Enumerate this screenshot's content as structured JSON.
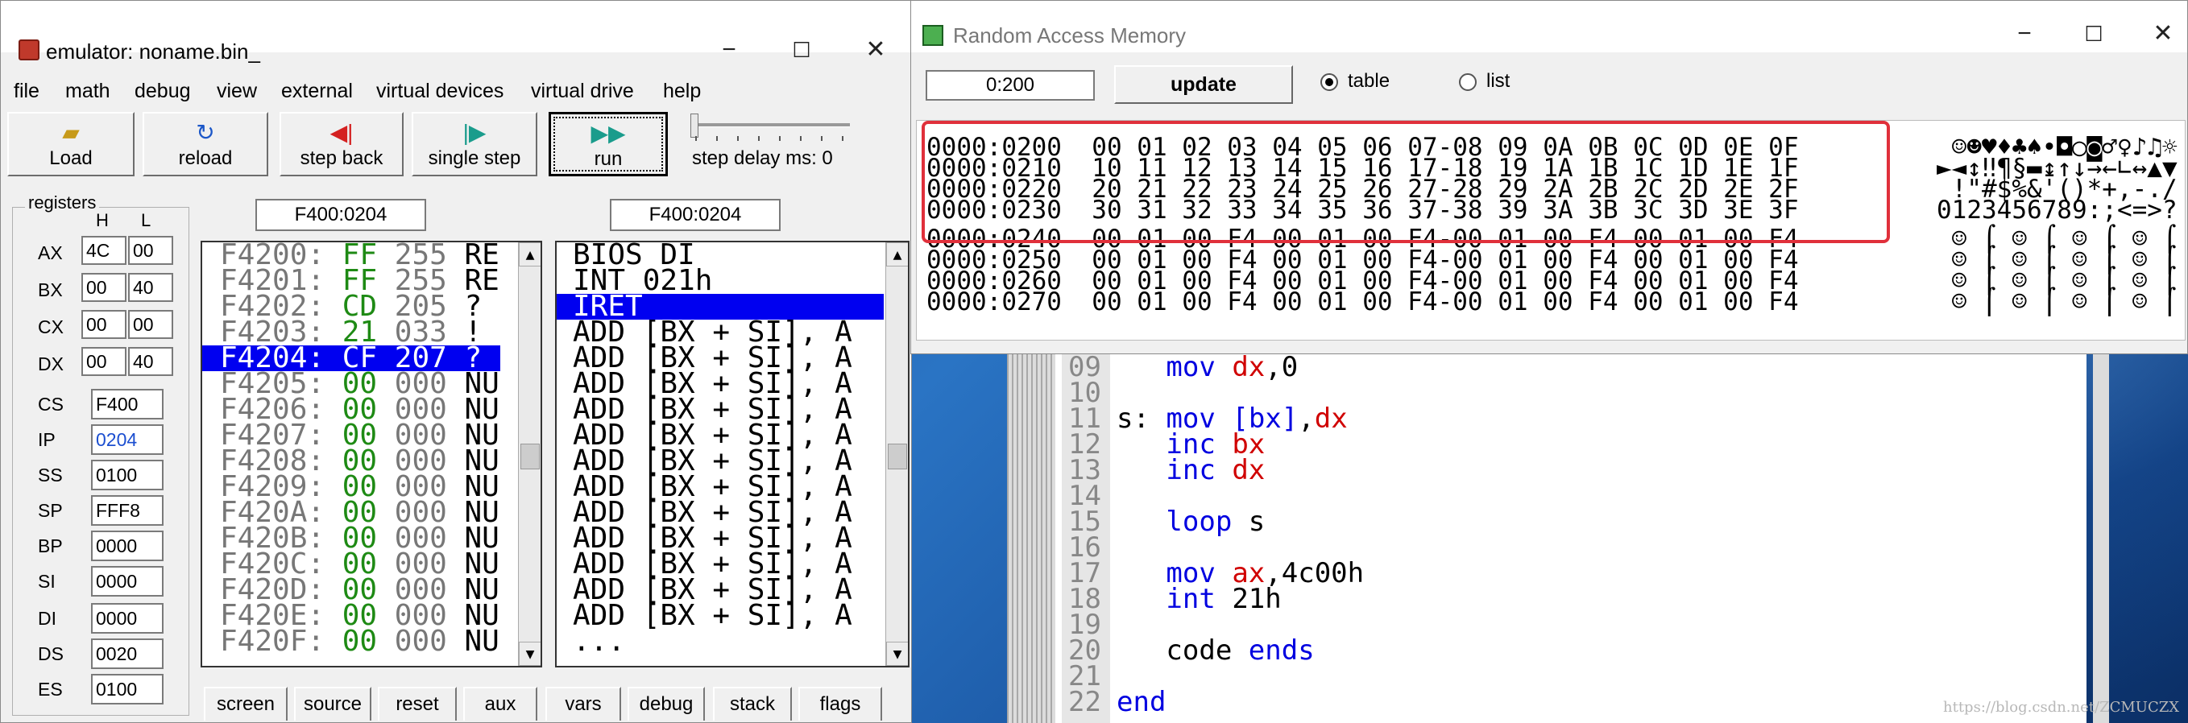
{
  "emulator": {
    "title": "emulator: noname.bin_",
    "menu": [
      "file",
      "math",
      "debug",
      "view",
      "external",
      "virtual devices",
      "virtual drive",
      "help"
    ],
    "toolbar": [
      {
        "label": "Load",
        "icon": "folder-icon"
      },
      {
        "label": "reload",
        "icon": "reload-icon"
      },
      {
        "label": "step back",
        "icon": "step-back-icon"
      },
      {
        "label": "single step",
        "icon": "single-step-icon"
      },
      {
        "label": "run",
        "icon": "run-icon"
      }
    ],
    "step_delay_label": "step delay ms: 0",
    "registers_title": "registers",
    "hl_labels": [
      "H",
      "L"
    ],
    "pair_registers": [
      {
        "name": "AX",
        "h": "4C",
        "l": "00"
      },
      {
        "name": "BX",
        "h": "00",
        "l": "40"
      },
      {
        "name": "CX",
        "h": "00",
        "l": "00"
      },
      {
        "name": "DX",
        "h": "00",
        "l": "40"
      }
    ],
    "word_registers": [
      {
        "name": "CS",
        "value": "F400"
      },
      {
        "name": "IP",
        "value": "0204"
      },
      {
        "name": "SS",
        "value": "0100"
      },
      {
        "name": "SP",
        "value": "FFF8"
      },
      {
        "name": "BP",
        "value": "0000"
      },
      {
        "name": "SI",
        "value": "0000"
      },
      {
        "name": "DI",
        "value": "0000"
      },
      {
        "name": "DS",
        "value": "0020"
      },
      {
        "name": "ES",
        "value": "0100"
      }
    ],
    "memory_address": "F400:0204",
    "disasm_address": "F400:0204",
    "memory_rows": [
      {
        "addr": "F4200:",
        "hex": "FF",
        "dec": "255",
        "chr": "RE"
      },
      {
        "addr": "F4201:",
        "hex": "FF",
        "dec": "255",
        "chr": "RE"
      },
      {
        "addr": "F4202:",
        "hex": "CD",
        "dec": "205",
        "chr": "?"
      },
      {
        "addr": "F4203:",
        "hex": "21",
        "dec": "033",
        "chr": "!"
      },
      {
        "addr": "F4204:",
        "hex": "CF",
        "dec": "207",
        "chr": "?"
      },
      {
        "addr": "F4205:",
        "hex": "00",
        "dec": "000",
        "chr": "NU"
      },
      {
        "addr": "F4206:",
        "hex": "00",
        "dec": "000",
        "chr": "NU"
      },
      {
        "addr": "F4207:",
        "hex": "00",
        "dec": "000",
        "chr": "NU"
      },
      {
        "addr": "F4208:",
        "hex": "00",
        "dec": "000",
        "chr": "NU"
      },
      {
        "addr": "F4209:",
        "hex": "00",
        "dec": "000",
        "chr": "NU"
      },
      {
        "addr": "F420A:",
        "hex": "00",
        "dec": "000",
        "chr": "NU"
      },
      {
        "addr": "F420B:",
        "hex": "00",
        "dec": "000",
        "chr": "NU"
      },
      {
        "addr": "F420C:",
        "hex": "00",
        "dec": "000",
        "chr": "NU"
      },
      {
        "addr": "F420D:",
        "hex": "00",
        "dec": "000",
        "chr": "NU"
      },
      {
        "addr": "F420E:",
        "hex": "00",
        "dec": "000",
        "chr": "NU"
      },
      {
        "addr": "F420F:",
        "hex": "00",
        "dec": "000",
        "chr": "NU"
      }
    ],
    "disasm_rows": [
      "BIOS DI",
      "INT 021h",
      "IRET",
      "ADD [BX + SI], A",
      "ADD [BX + SI], A",
      "ADD [BX + SI], A",
      "ADD [BX + SI], A",
      "ADD [BX + SI], A",
      "ADD [BX + SI], A",
      "ADD [BX + SI], A",
      "ADD [BX + SI], A",
      "ADD [BX + SI], A",
      "ADD [BX + SI], A",
      "ADD [BX + SI], A",
      "ADD [BX + SI], A",
      "..."
    ],
    "bottom_tabs": [
      "screen",
      "source",
      "reset",
      "aux",
      "vars",
      "debug",
      "stack",
      "flags"
    ],
    "colors": {
      "selection": "#0000f0",
      "hex_green": "#1e8a14"
    }
  },
  "ram": {
    "title": "Random Access Memory",
    "address": "0:200",
    "update_label": "update",
    "radio_table": "table",
    "radio_list": "list",
    "rows": [
      "0000:0200  00 01 02 03 04 05 06 07-08 09 0A 0B 0C 0D 0E 0F",
      "0000:0210  10 11 12 13 14 15 16 17-18 19 1A 1B 1C 1D 1E 1F",
      "0000:0220  20 21 22 23 24 25 26 27-28 29 2A 2B 2C 2D 2E 2F",
      "0000:0230  30 31 32 33 34 35 36 37-38 39 3A 3B 3C 3D 3E 3F",
      "0000:0240  00 01 00 F4 00 01 00 F4-00 01 00 F4 00 01 00 F4",
      "0000:0250  00 01 00 F4 00 01 00 F4-00 01 00 F4 00 01 00 F4",
      "0000:0260  00 01 00 F4 00 01 00 F4-00 01 00 F4 00 01 00 F4",
      "0000:0270  00 01 00 F4 00 01 00 F4-00 01 00 F4 00 01 00 F4"
    ],
    "ascii": [
      " ☺☻♥♦♣♠•◘○◙♂♀♪♫☼",
      "►◄↕‼¶§▬↨↑↓→←∟↔▲▼",
      " !\"#$%&'()*+,-./",
      "0123456789:;<=>?",
      " ☺ ⌠ ☺ ⌠ ☺ ⌠ ☺ ⌠",
      " ☺ ⌠ ☺ ⌠ ☺ ⌠ ☺ ⌠",
      " ☺ ⌠ ☺ ⌠ ☺ ⌠ ☺ ⌠",
      " ☺ ⌠ ☺ ⌠ ☺ ⌠ ☺ ⌠"
    ],
    "highlight_color": "#e0303b"
  },
  "source": {
    "line_numbers": [
      "09",
      "10",
      "11",
      "12",
      "13",
      "14",
      "15",
      "16",
      "17",
      "18",
      "19",
      "20",
      "21",
      "22"
    ],
    "lines": {
      "l09_kw": "mov",
      "l09_reg": "dx",
      "l09_rest": ",0",
      "l11_label": "s:",
      "l11_kw": "mov",
      "l11_mem": "[bx]",
      "l11_comma": ",",
      "l11_reg": "dx",
      "l12_kw": "inc",
      "l12_reg": "bx",
      "l13_kw": "inc",
      "l13_reg": "dx",
      "l15_kw": "loop",
      "l15_rest": "s",
      "l17_kw": "mov",
      "l17_reg": "ax",
      "l17_rest": ",4c00h",
      "l18_kw": "int",
      "l18_rest": "21h",
      "l20_name": "code",
      "l20_kw": "ends",
      "l22_kw": "end"
    },
    "watermark": "https://blog.csdn.net/ZCMUCZX"
  }
}
